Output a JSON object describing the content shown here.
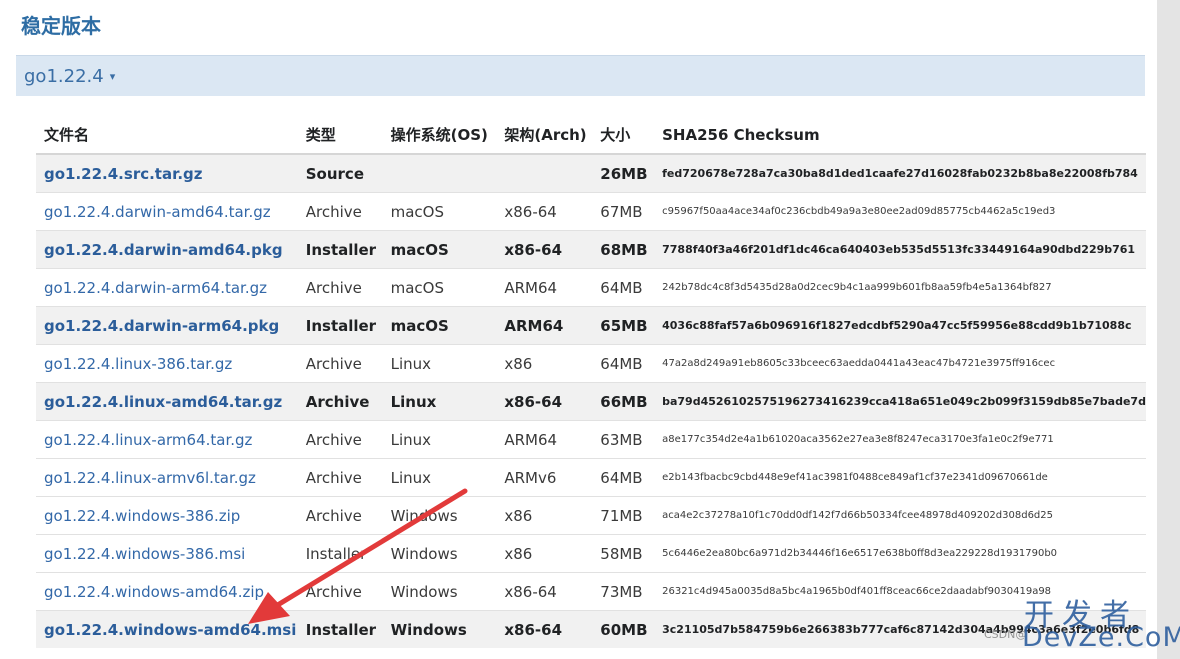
{
  "section_title": "稳定版本",
  "version": {
    "label": "go1.22.4",
    "caret": "▾"
  },
  "table": {
    "headers": [
      "文件名",
      "类型",
      "操作系统(OS)",
      "架构(Arch)",
      "大小",
      "SHA256 Checksum"
    ],
    "rows": [
      {
        "file": "go1.22.4.src.tar.gz",
        "kind": "Source",
        "os": "",
        "arch": "",
        "size": "26MB",
        "sha": "fed720678e728a7ca30ba8d1ded1caafe27d16028fab0232b8ba8e22008fb784",
        "featured": true
      },
      {
        "file": "go1.22.4.darwin-amd64.tar.gz",
        "kind": "Archive",
        "os": "macOS",
        "arch": "x86-64",
        "size": "67MB",
        "sha": "c95967f50aa4ace34af0c236cbdb49a9a3e80ee2ad09d85775cb4462a5c19ed3",
        "featured": false
      },
      {
        "file": "go1.22.4.darwin-amd64.pkg",
        "kind": "Installer",
        "os": "macOS",
        "arch": "x86-64",
        "size": "68MB",
        "sha": "7788f40f3a46f201df1dc46ca640403eb535d5513fc33449164a90dbd229b761",
        "featured": true
      },
      {
        "file": "go1.22.4.darwin-arm64.tar.gz",
        "kind": "Archive",
        "os": "macOS",
        "arch": "ARM64",
        "size": "64MB",
        "sha": "242b78dc4c8f3d5435d28a0d2cec9b4c1aa999b601fb8aa59fb4e5a1364bf827",
        "featured": false
      },
      {
        "file": "go1.22.4.darwin-arm64.pkg",
        "kind": "Installer",
        "os": "macOS",
        "arch": "ARM64",
        "size": "65MB",
        "sha": "4036c88faf57a6b096916f1827edcdbf5290a47cc5f59956e88cdd9b1b71088c",
        "featured": true
      },
      {
        "file": "go1.22.4.linux-386.tar.gz",
        "kind": "Archive",
        "os": "Linux",
        "arch": "x86",
        "size": "64MB",
        "sha": "47a2a8d249a91eb8605c33bceec63aedda0441a43eac47b4721e3975ff916cec",
        "featured": false
      },
      {
        "file": "go1.22.4.linux-amd64.tar.gz",
        "kind": "Archive",
        "os": "Linux",
        "arch": "x86-64",
        "size": "66MB",
        "sha": "ba79d4526102575196273416239cca418a651e049c2b099f3159db85e7bade7d",
        "featured": true
      },
      {
        "file": "go1.22.4.linux-arm64.tar.gz",
        "kind": "Archive",
        "os": "Linux",
        "arch": "ARM64",
        "size": "63MB",
        "sha": "a8e177c354d2e4a1b61020aca3562e27ea3e8f8247eca3170e3fa1e0c2f9e771",
        "featured": false
      },
      {
        "file": "go1.22.4.linux-armv6l.tar.gz",
        "kind": "Archive",
        "os": "Linux",
        "arch": "ARMv6",
        "size": "64MB",
        "sha": "e2b143fbacbc9cbd448e9ef41ac3981f0488ce849af1cf37e2341d09670661de",
        "featured": false
      },
      {
        "file": "go1.22.4.windows-386.zip",
        "kind": "Archive",
        "os": "Windows",
        "arch": "x86",
        "size": "71MB",
        "sha": "aca4e2c37278a10f1c70dd0df142f7d66b50334fcee48978d409202d308d6d25",
        "featured": false
      },
      {
        "file": "go1.22.4.windows-386.msi",
        "kind": "Installer",
        "os": "Windows",
        "arch": "x86",
        "size": "58MB",
        "sha": "5c6446e2ea80bc6a971d2b34446f16e6517e638b0ff8d3ea229228d1931790b0",
        "featured": false
      },
      {
        "file": "go1.22.4.windows-amd64.zip",
        "kind": "Archive",
        "os": "Windows",
        "arch": "x86-64",
        "size": "73MB",
        "sha": "26321c4d945a0035d8a5bc4a1965b0df401ff8ceac66ce2daadabf9030419a98",
        "featured": false
      },
      {
        "file": "go1.22.4.windows-amd64.msi",
        "kind": "Installer",
        "os": "Windows",
        "arch": "x86-64",
        "size": "60MB",
        "sha": "3c21105d7b584759b6e266383b777caf6c87142d304a4b994c3a6e3f2e0b6fd8",
        "featured": true
      }
    ]
  },
  "watermark": {
    "cn": "开发者",
    "en": "DevZe.CoM",
    "small": "CSDN@"
  },
  "colors": {
    "link": "#3368a8",
    "arrow": "#e23a3a",
    "version_bar": "#dbe7f3"
  }
}
